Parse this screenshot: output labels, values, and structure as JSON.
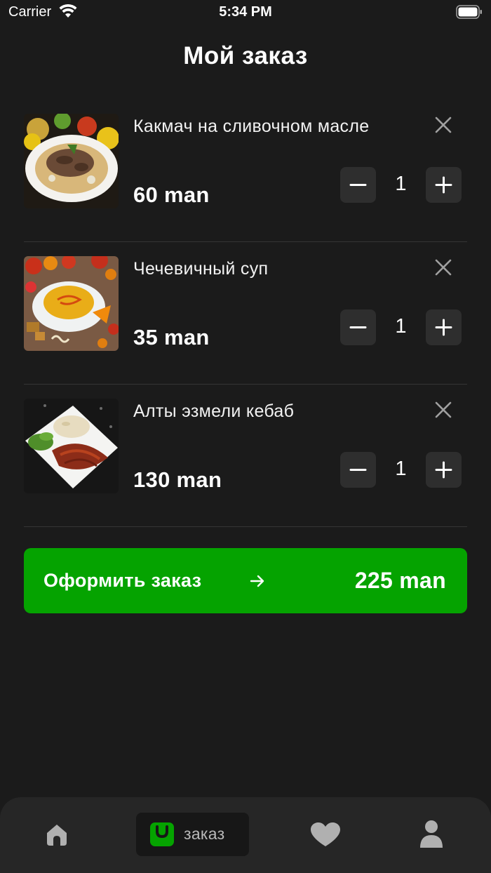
{
  "status_bar": {
    "carrier": "Carrier",
    "time": "5:34 PM"
  },
  "page": {
    "title": "Мой заказ"
  },
  "order": {
    "items": [
      {
        "name": "Какмач на сливочном масле",
        "price": "60 man",
        "quantity": "1",
        "image_icon": "dish-kakmach-photo"
      },
      {
        "name": "Чечевичный суп",
        "price": "35 man",
        "quantity": "1",
        "image_icon": "dish-lentil-soup-photo"
      },
      {
        "name": "Алты эзмели кебаб",
        "price": "130 man",
        "quantity": "1",
        "image_icon": "dish-kebab-photo"
      }
    ],
    "remove_icon": "close-icon",
    "minus_icon": "minus-icon",
    "plus_icon": "plus-icon"
  },
  "checkout": {
    "label": "Оформить заказ",
    "arrow_icon": "arrow-right-icon",
    "total": "225 man",
    "color": "#05a300"
  },
  "tab_bar": {
    "tabs": [
      {
        "id": "home",
        "icon": "home-icon",
        "label": ""
      },
      {
        "id": "order",
        "icon": "bag-icon",
        "label": "заказ",
        "active": true
      },
      {
        "id": "favorites",
        "icon": "heart-icon",
        "label": ""
      },
      {
        "id": "profile",
        "icon": "user-icon",
        "label": ""
      }
    ],
    "active_color": "#05a300",
    "icon_color": "#b0b0b0"
  },
  "colors": {
    "background": "#1b1b1b",
    "surface": "#2e2e2e",
    "accent": "#05a300",
    "text": "#ffffff"
  }
}
